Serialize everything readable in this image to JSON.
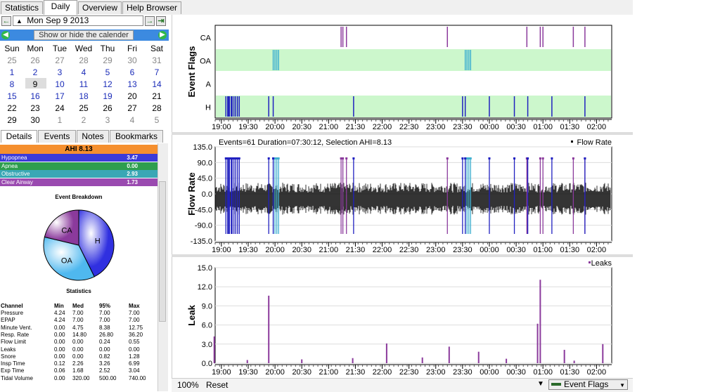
{
  "tabs": {
    "statistics": "Statistics",
    "daily": "Daily",
    "overview": "Overview",
    "help": "Help Browser"
  },
  "nav": {
    "date": "Mon Sep 9 2013",
    "calendar_toggle": "Show or hide the calender"
  },
  "calendar": {
    "days": [
      "Sun",
      "Mon",
      "Tue",
      "Wed",
      "Thu",
      "Fri",
      "Sat"
    ],
    "weeks": [
      [
        [
          "25",
          "dim"
        ],
        [
          "26",
          "dim"
        ],
        [
          "27",
          "dim"
        ],
        [
          "28",
          "dim"
        ],
        [
          "29",
          "dim"
        ],
        [
          "30",
          "dim"
        ],
        [
          "31",
          "dim"
        ]
      ],
      [
        [
          "1",
          "blue"
        ],
        [
          "2",
          "blue"
        ],
        [
          "3",
          "blue"
        ],
        [
          "4",
          "blue"
        ],
        [
          "5",
          "blue"
        ],
        [
          "6",
          "blue"
        ],
        [
          "7",
          "blue"
        ]
      ],
      [
        [
          "8",
          "blue"
        ],
        [
          "9",
          "blk"
        ],
        [
          "10",
          "blue"
        ],
        [
          "11",
          "blue"
        ],
        [
          "12",
          "blue"
        ],
        [
          "13",
          "blue"
        ],
        [
          "14",
          "blue"
        ]
      ],
      [
        [
          "15",
          "blue"
        ],
        [
          "16",
          "blue"
        ],
        [
          "17",
          "blue"
        ],
        [
          "18",
          "blue"
        ],
        [
          "19",
          "blue"
        ],
        [
          "20",
          "blk"
        ],
        [
          "21",
          "blk"
        ]
      ],
      [
        [
          "22",
          "blk"
        ],
        [
          "23",
          "blk"
        ],
        [
          "24",
          "blk"
        ],
        [
          "25",
          "blk"
        ],
        [
          "26",
          "blk"
        ],
        [
          "27",
          "blk"
        ],
        [
          "28",
          "blk"
        ]
      ],
      [
        [
          "29",
          "blk"
        ],
        [
          "30",
          "blk"
        ],
        [
          "1",
          "dim"
        ],
        [
          "2",
          "dim"
        ],
        [
          "3",
          "dim"
        ],
        [
          "4",
          "dim"
        ],
        [
          "5",
          "dim"
        ]
      ]
    ]
  },
  "detail_tabs": {
    "details": "Details",
    "events": "Events",
    "notes": "Notes",
    "bookmarks": "Bookmarks"
  },
  "ahi": {
    "title": "AHI 8.13",
    "rows": [
      {
        "label": "Hypopnea",
        "value": "3.47",
        "color": "#3b3bd8"
      },
      {
        "label": "Apnea",
        "value": "0.00",
        "color": "#2e9e4f"
      },
      {
        "label": "Obstructive",
        "value": "2.93",
        "color": "#3aa7b5"
      },
      {
        "label": "Clear Airway",
        "value": "1.73",
        "color": "#9a4ab0"
      }
    ]
  },
  "breakdown": {
    "title": "Event Breakdown",
    "slices": [
      {
        "label": "H",
        "value": 3.47,
        "color": "#3030e0"
      },
      {
        "label": "OA",
        "value": 2.93,
        "color": "#4fb8ef"
      },
      {
        "label": "CA",
        "value": 1.73,
        "color": "#8b3a9c"
      }
    ]
  },
  "statistics": {
    "title": "Statistics",
    "headers": [
      "Channel",
      "Min",
      "Med",
      "95%",
      "Max"
    ],
    "rows": [
      [
        "Pressure",
        "4.24",
        "7.00",
        "7.00",
        "7.00"
      ],
      [
        "EPAP",
        "4.24",
        "7.00",
        "7.00",
        "7.00"
      ],
      [
        "Minute Vent.",
        "0.00",
        "4.75",
        "8.38",
        "12.75"
      ],
      [
        "Resp. Rate",
        "0.00",
        "14.80",
        "26.80",
        "36.20"
      ],
      [
        "Flow Limit",
        "0.00",
        "0.00",
        "0.24",
        "0.55"
      ],
      [
        "Leaks",
        "0.00",
        "0.00",
        "0.00",
        "0.00"
      ],
      [
        "Snore",
        "0.00",
        "0.00",
        "0.82",
        "1.28"
      ],
      [
        "Insp Time",
        "0.12",
        "2.26",
        "3.26",
        "6.99"
      ],
      [
        "Exp Time",
        "0.06",
        "1.68",
        "2.52",
        "3.04"
      ],
      [
        "Tidal Volume",
        "0.00",
        "320.00",
        "500.00",
        "740.00"
      ]
    ]
  },
  "chart_data": [
    {
      "type": "event-flags",
      "ylabel": "Event Flags",
      "rows": [
        "CA",
        "OA",
        "A",
        "H"
      ],
      "x_ticks": [
        "19:00",
        "19:30",
        "20:00",
        "20:30",
        "21:00",
        "21:30",
        "22:00",
        "22:30",
        "23:00",
        "23:30",
        "00:00",
        "00:30",
        "01:00",
        "01:30",
        "02:00"
      ],
      "events": {
        "CA": [
          "21:14",
          "21:16",
          "21:20",
          "23:13",
          "00:42",
          "00:57",
          "01:00",
          "01:34",
          "01:47"
        ],
        "OA": [
          "19:58",
          "20:00",
          "20:02",
          "20:04",
          "23:33",
          "23:35",
          "23:37",
          "23:39"
        ],
        "H": [
          "19:05",
          "19:07",
          "19:08",
          "19:09",
          "19:11",
          "19:12",
          "19:14",
          "19:16",
          "19:18",
          "19:20",
          "19:53",
          "19:58",
          "21:28",
          "23:30",
          "23:33",
          "00:00",
          "00:28",
          "00:43",
          "01:10",
          "01:47"
        ]
      }
    },
    {
      "type": "line",
      "title": "Events=61 Duration=07:30:12, Selection AHI=8.13",
      "ylabel": "Flow Rate",
      "legend": "Flow Rate",
      "yticks": [
        "135.0",
        "90.0",
        "45.0",
        "0.0",
        "-45.0",
        "-90.0",
        "-135.0"
      ],
      "ylim": [
        -135,
        135
      ]
    },
    {
      "type": "bar",
      "ylabel": "Leak",
      "legend": "Leaks",
      "yticks": [
        "15.0",
        "12.0",
        "9.0",
        "6.0",
        "3.0",
        "0.0"
      ],
      "ylim": [
        0,
        15
      ],
      "x": [
        "18:52",
        "19:29",
        "19:53",
        "20:30",
        "21:27",
        "22:05",
        "22:45",
        "23:15",
        "23:48",
        "00:19",
        "00:54",
        "00:57",
        "01:24",
        "01:35",
        "02:07"
      ],
      "values": [
        4.2,
        0.5,
        10.6,
        0.6,
        0.8,
        3.1,
        0.9,
        2.6,
        1.8,
        0.7,
        6.2,
        13.1,
        2.1,
        0.4,
        3.0
      ]
    }
  ],
  "bottom": {
    "zoom": "100%",
    "reset": "Reset",
    "select": "Event Flags"
  }
}
